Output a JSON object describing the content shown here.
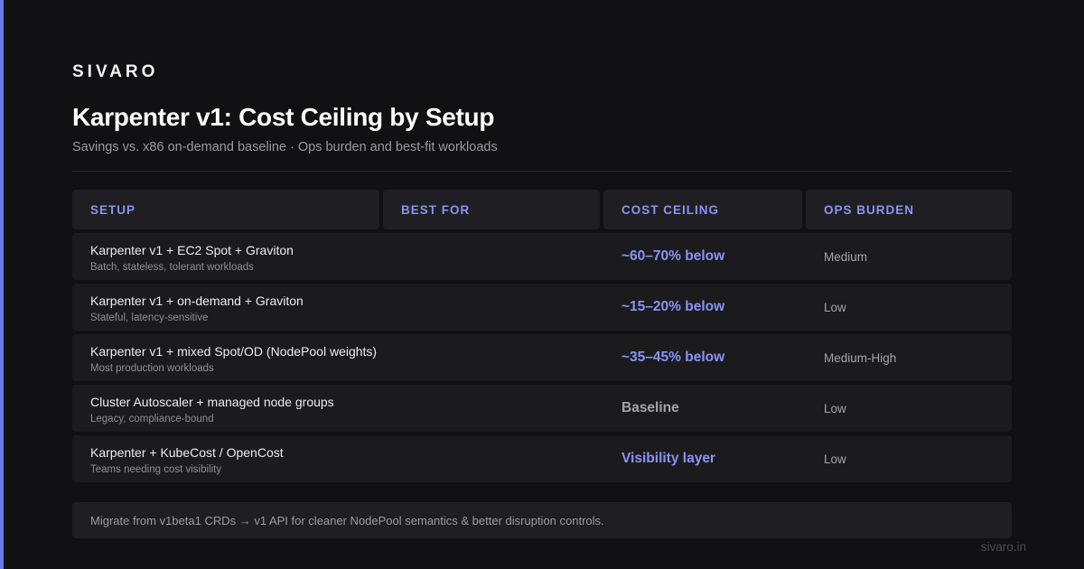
{
  "brand": "SIVARO",
  "title": "Karpenter v1: Cost Ceiling by Setup",
  "subtitle": "Savings vs. x86 on-demand baseline · Ops burden and best-fit workloads",
  "colors": {
    "accent": "#6e78e6",
    "highlight": "#8a93f2",
    "background": "#111113"
  },
  "table": {
    "headers": [
      "SETUP",
      "BEST FOR",
      "COST CEILING",
      "OPS BURDEN"
    ],
    "rows": [
      {
        "setup": "Karpenter v1 + EC2 Spot + Graviton",
        "best_for": "Batch, stateless, tolerant workloads",
        "cost_ceiling": "~60–70% below",
        "ops_burden": "Medium"
      },
      {
        "setup": "Karpenter v1 + on-demand + Graviton",
        "best_for": "Stateful, latency-sensitive",
        "cost_ceiling": "~15–20% below",
        "ops_burden": "Low"
      },
      {
        "setup": "Karpenter v1 + mixed Spot/OD (NodePool weights)",
        "best_for": "Most production workloads",
        "cost_ceiling": "~35–45% below",
        "ops_burden": "Medium-High"
      },
      {
        "setup": "Cluster Autoscaler + managed node groups",
        "best_for": "Legacy, compliance-bound",
        "cost_ceiling": "Baseline",
        "ops_burden": "Low"
      },
      {
        "setup": "Karpenter + KubeCost / OpenCost",
        "best_for": "Teams needing cost visibility",
        "cost_ceiling": "Visibility layer",
        "ops_burden": "Low"
      }
    ]
  },
  "note": "Migrate from v1beta1 CRDs → v1 API for cleaner NodePool semantics & better disruption controls.",
  "footer": "sivaro.in"
}
